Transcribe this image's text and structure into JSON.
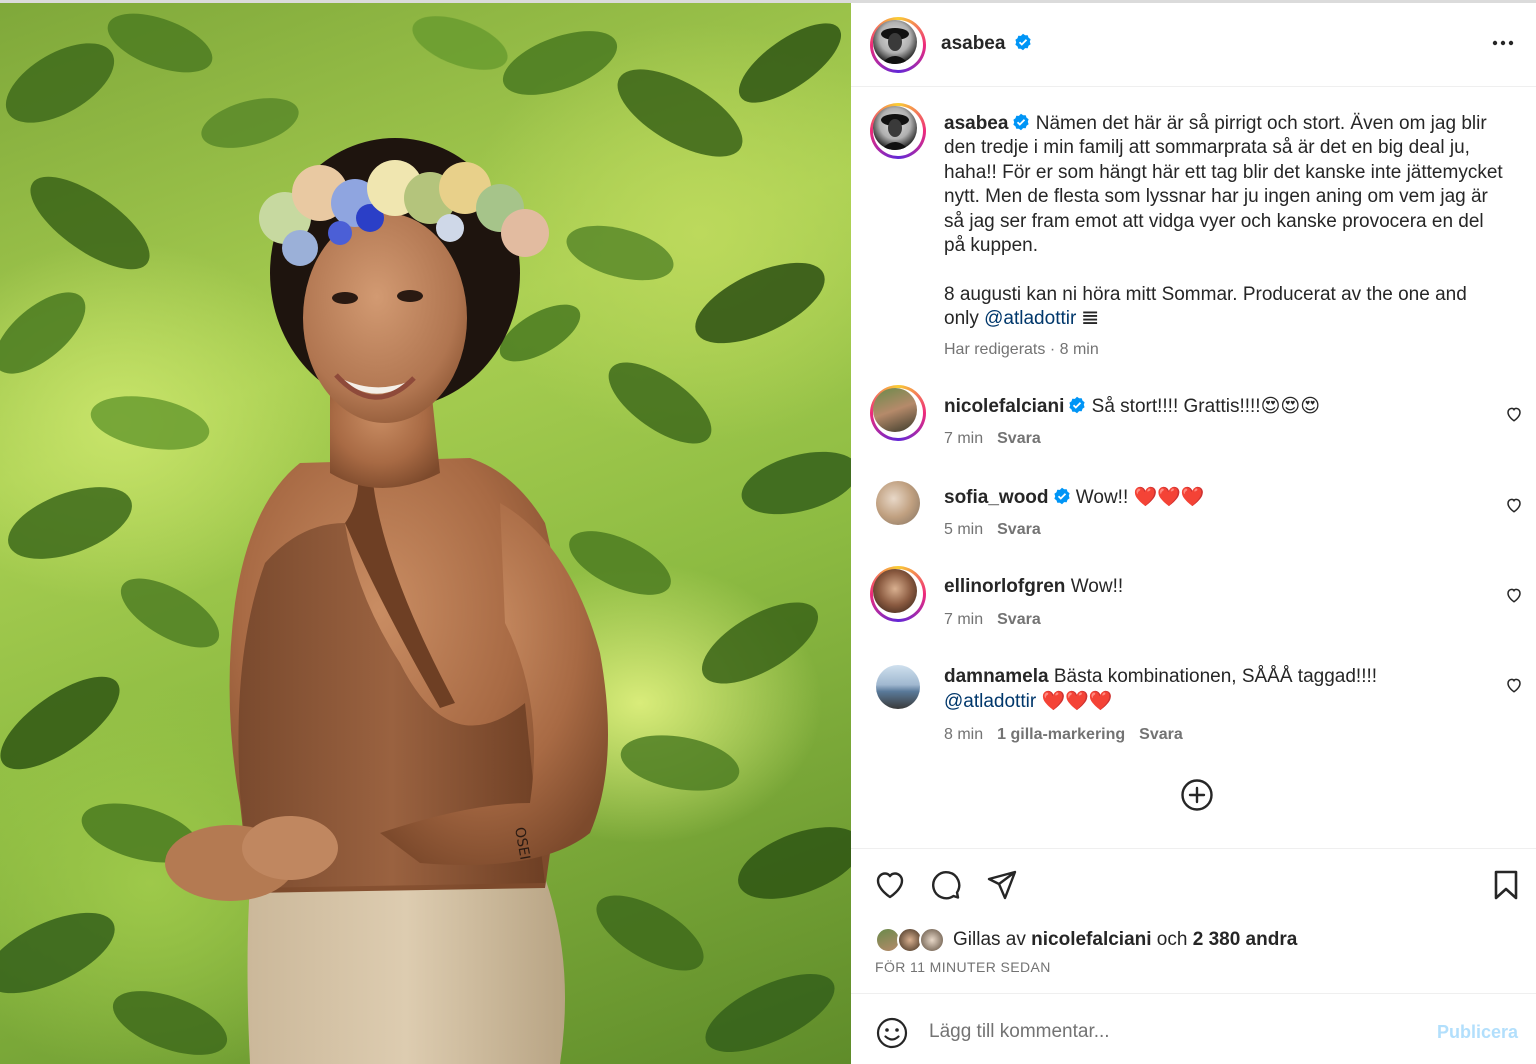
{
  "post": {
    "author": "asabea",
    "verified": true
  },
  "caption": {
    "username": "asabea",
    "paragraph1": "Nämen det här är så pirrigt och stort. Även om jag blir den tredje i min familj att sommarprata så är det en big deal ju, haha!! För er som hängt här ett tag blir det kanske inte jättemycket nytt. Men de flesta som lyssnar har ju ingen aning om vem jag är så jag ser fram emot att vidga vyer och kanske provocera en del på kuppen.",
    "paragraph2_prefix": "8 augusti kan ni höra mitt Sommar. Producerat av the one and only ",
    "paragraph2_mention": "@atladottir",
    "paragraph2_suffix": " 𝌆",
    "edited": "Har redigerats",
    "separator": " · ",
    "time": "8 min"
  },
  "comments": [
    {
      "username": "nicolefalciani",
      "verified": true,
      "text": "Så stort!!!! Grattis!!!!",
      "emoji": "😍😍😍",
      "time": "7 min",
      "reply": "Svara",
      "has_ring": true
    },
    {
      "username": "sofia_wood",
      "verified": true,
      "text": "Wow!!",
      "emoji": "❤️❤️❤️",
      "time": "5 min",
      "reply": "Svara",
      "has_ring": false
    },
    {
      "username": "ellinorlofgren",
      "verified": false,
      "text": "Wow!!",
      "time": "7 min",
      "reply": "Svara",
      "has_ring": true
    },
    {
      "username": "damnamela",
      "verified": false,
      "text": "Bästa kombinationen, SÅÅÅ taggad!!!!",
      "mention": "@atladottir",
      "emoji": "❤️❤️❤️",
      "time": "8 min",
      "likes": "1 gilla-markering",
      "reply": "Svara",
      "has_ring": false
    }
  ],
  "likes": {
    "prefix": "Gillas av ",
    "user": "nicolefalciani",
    "middle": " och ",
    "others": "2 380 andra"
  },
  "timestamp": "FÖR 11 MINUTER SEDAN",
  "add_comment": {
    "placeholder": "Lägg till kommentar...",
    "publish": "Publicera"
  },
  "photo": {
    "tattoo": "OSEI"
  },
  "colors": {
    "verified": "#0095f6",
    "mention": "#00376b",
    "muted": "#737373",
    "publish_disabled": "#b2dffc"
  },
  "icons": [
    "more-icon",
    "verified-icon",
    "heart-icon",
    "comment-icon",
    "share-icon",
    "bookmark-icon",
    "plus-circle-icon",
    "emoji-icon"
  ]
}
